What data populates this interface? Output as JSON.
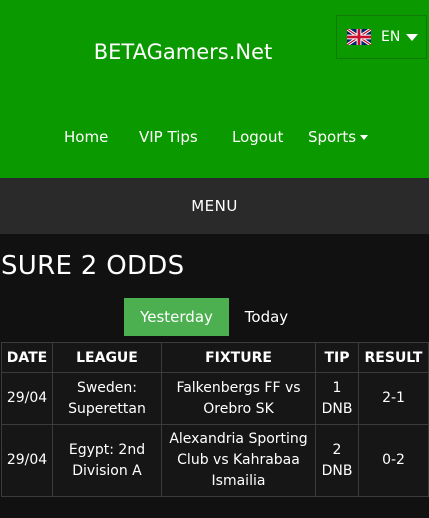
{
  "site": {
    "title": "BETAGamers.Net"
  },
  "language": {
    "code": "EN",
    "flag_icon": "uk-flag-icon"
  },
  "nav": {
    "items": [
      {
        "label": "Home"
      },
      {
        "label": "VIP Tips"
      },
      {
        "label": "Logout"
      },
      {
        "label": "Sports",
        "has_dropdown": true
      }
    ]
  },
  "menu": {
    "label": "MENU"
  },
  "page": {
    "heading": "SURE 2 ODDS"
  },
  "tabs": [
    {
      "label": "Yesterday",
      "active": true
    },
    {
      "label": "Today",
      "active": false
    }
  ],
  "table": {
    "columns": [
      "DATE",
      "LEAGUE",
      "FIXTURE",
      "TIP",
      "RESULT"
    ],
    "rows": [
      [
        "29/04",
        "Sweden: Superettan",
        "Falkenbergs FF vs Orebro SK",
        "1 DNB",
        "2-1"
      ],
      [
        "29/04",
        "Egypt: 2nd Division A",
        "Alexandria Sporting Club vs Kahrabaa Ismailia",
        "2 DNB",
        "0-2"
      ]
    ]
  },
  "colors": {
    "header_bg": "#0b9900",
    "menu_bg": "#2a2a2a",
    "active_tab": "#4caf50",
    "page_bg": "#111111"
  }
}
